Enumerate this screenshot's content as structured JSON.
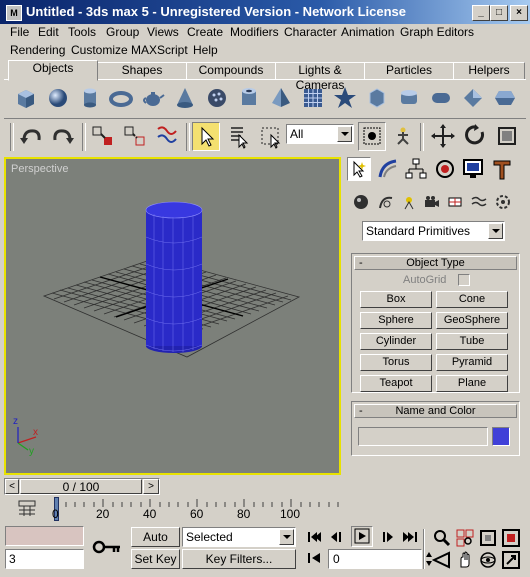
{
  "window": {
    "icon_text": "M",
    "title": "Untitled - 3ds max 5 - Unregistered Version - Network License",
    "minimize": "_",
    "maximize": "□",
    "close": "×"
  },
  "menu": [
    "File",
    "Edit",
    "Tools",
    "Group",
    "Views",
    "Create",
    "Modifiers",
    "Character",
    "Animation",
    "Graph Editors",
    "Rendering",
    "Customize",
    "MAXScript",
    "Help"
  ],
  "tabs": [
    "Objects",
    "Shapes",
    "Compounds",
    "Lights & Cameras",
    "Particles",
    "Helpers"
  ],
  "objects_icons": [
    "box-icon",
    "sphere-icon",
    "cylinder-icon",
    "torus-icon",
    "teapot-icon",
    "cone-icon",
    "geosphere-icon",
    "tube-icon",
    "pyramid-icon",
    "plane-icon",
    "hedra-icon",
    "chamferbox-icon",
    "oiltank-icon",
    "capsule-icon",
    "spindle-icon",
    "gengon-icon"
  ],
  "toolbar": {
    "selection_filter": "All"
  },
  "viewport": {
    "label": "Perspective",
    "axis_x": "x",
    "axis_y": "y",
    "axis_z": "z",
    "object_color": "#2a2ac8"
  },
  "command_panel": {
    "category_dropdown": "Standard Primitives",
    "object_type": {
      "header": "Object Type",
      "autogrid_label": "AutoGrid",
      "buttons": [
        "Box",
        "Cone",
        "Sphere",
        "GeoSphere",
        "Cylinder",
        "Tube",
        "Torus",
        "Pyramid",
        "Teapot",
        "Plane"
      ]
    },
    "name_color": {
      "header": "Name and Color",
      "name_value": "",
      "color": "#4040d8"
    },
    "collapse_glyph": "-"
  },
  "timeline": {
    "frame_display": "0 / 100",
    "prev": "<",
    "next": ">",
    "ticks": [
      "0",
      "20",
      "40",
      "60",
      "80",
      "100"
    ]
  },
  "status": {
    "spinner_value": "3",
    "auto_key": "Auto Key",
    "set_key": "Set Key",
    "selected_dropdown": "Selected",
    "key_filters": "Key Filters...",
    "frame_field": "0"
  }
}
